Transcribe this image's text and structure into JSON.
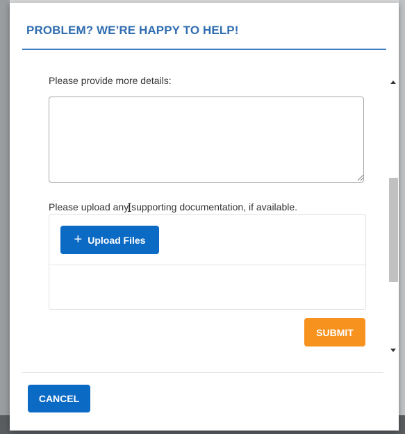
{
  "modal": {
    "title": "PROBLEM? WE’RE HAPPY TO HELP!",
    "details_label": "Please provide more details:",
    "details_value": "",
    "upload_label": "Please upload any supporting documentation, if available.",
    "upload_button_label": "Upload Files",
    "upload_button_icon": "plus-icon",
    "submit_label": "SUBMIT",
    "cancel_label": "CANCEL"
  },
  "colors": {
    "title": "#2f6db0",
    "primary_button": "#0b6bc4",
    "submit_button": "#f7921e",
    "header_rule": "#3f7fc4"
  }
}
